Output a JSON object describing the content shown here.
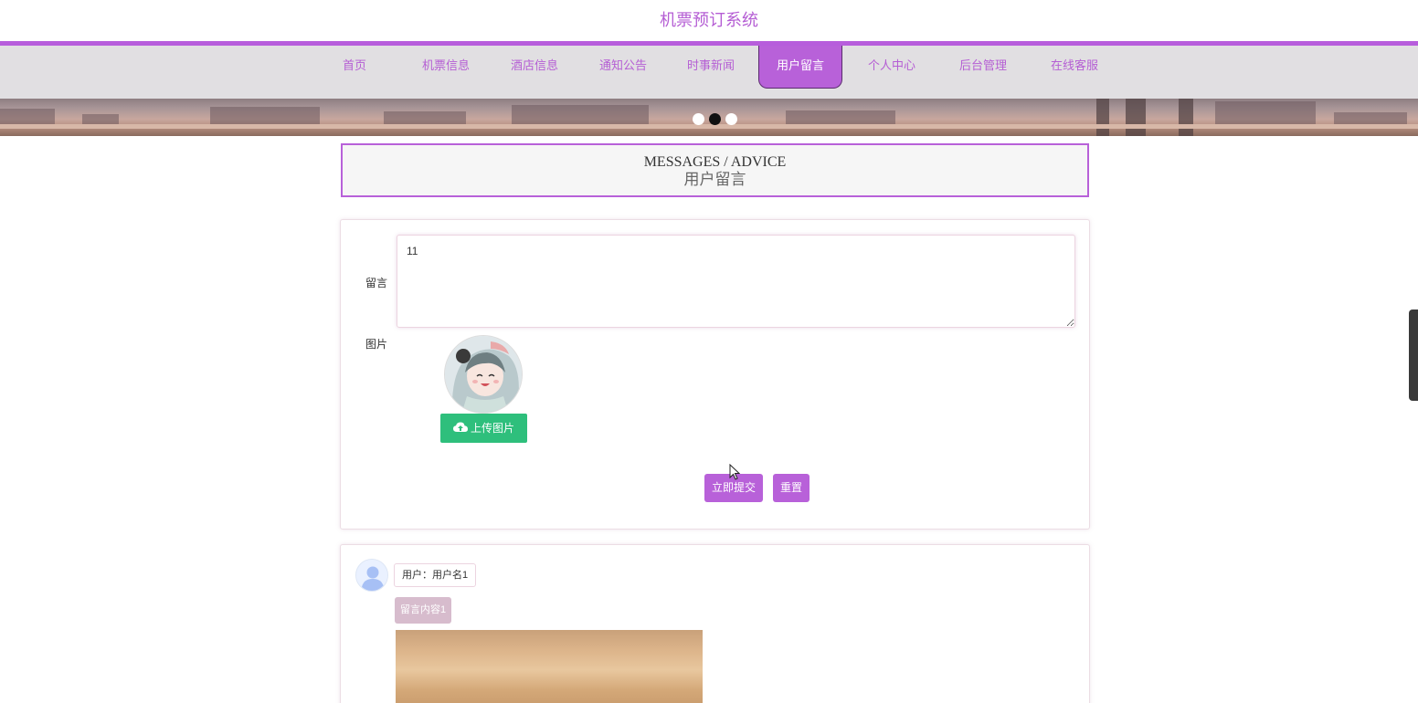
{
  "site": {
    "title": "机票预订系统"
  },
  "nav": {
    "items": [
      {
        "label": "首页",
        "active": false
      },
      {
        "label": "机票信息",
        "active": false
      },
      {
        "label": "酒店信息",
        "active": false
      },
      {
        "label": "通知公告",
        "active": false
      },
      {
        "label": "时事新闻",
        "active": false
      },
      {
        "label": "用户留言",
        "active": true
      },
      {
        "label": "个人中心",
        "active": false
      },
      {
        "label": "后台管理",
        "active": false
      },
      {
        "label": "在线客服",
        "active": false
      }
    ]
  },
  "carousel": {
    "slide_count": 3,
    "active_index": 1
  },
  "section": {
    "title_en": "MESSAGES / ADVICE",
    "title_cn": "用户留言"
  },
  "form": {
    "message_label": "留言",
    "message_value": "11",
    "image_label": "图片",
    "upload_label": "上传图片",
    "submit_label": "立即提交",
    "reset_label": "重置"
  },
  "comments": [
    {
      "user": "用户：用户名1",
      "content": "留言内容1"
    }
  ],
  "colors": {
    "accent": "#b861d9",
    "upload": "#2ebf7c",
    "nav_bg": "#e1dfe2",
    "tag_bg": "#d7bccd"
  },
  "icons": {
    "upload": "cloud-upload-icon",
    "default_avatar": "user-avatar-icon"
  }
}
